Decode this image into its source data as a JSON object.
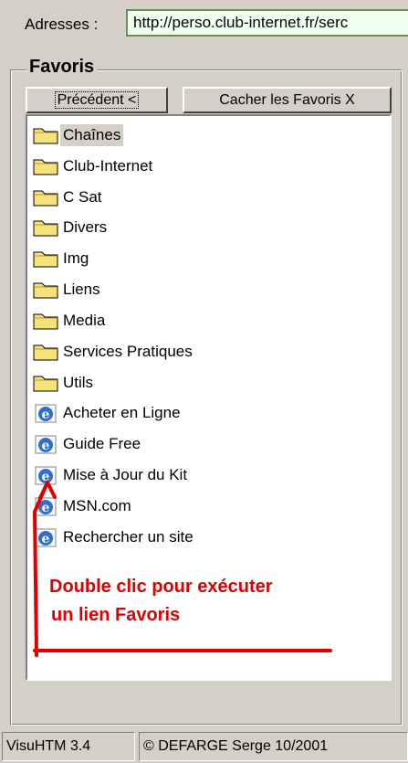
{
  "address_bar": {
    "label": "Adresses :",
    "value": "http://perso.club-internet.fr/serc"
  },
  "favorites": {
    "title": "Favoris",
    "back_button": "Précédent <",
    "hide_button": "Cacher les Favoris X",
    "folders": [
      "Chaînes",
      "Club-Internet",
      "C Sat",
      "Divers",
      "Img",
      "Liens",
      "Media",
      "Services Pratiques",
      "Utils"
    ],
    "links": [
      "Acheter en Ligne",
      "Guide Free",
      "Mise à Jour du Kit",
      "MSN.com",
      "Rechercher un site"
    ],
    "selected_item": "Chaînes"
  },
  "annotation": {
    "line1": "Double clic pour exécuter",
    "line2": "un lien Favoris",
    "color": "#e00000"
  },
  "status_bar": {
    "app": "VisuHTM 3.4",
    "copyright": "© DEFARGE Serge 10/2001"
  },
  "colors": {
    "window_bg": "#d4d0c8",
    "address_bg": "#f0fff0",
    "folder": "#f6e27a",
    "ie_blue": "#2f6fd0"
  }
}
